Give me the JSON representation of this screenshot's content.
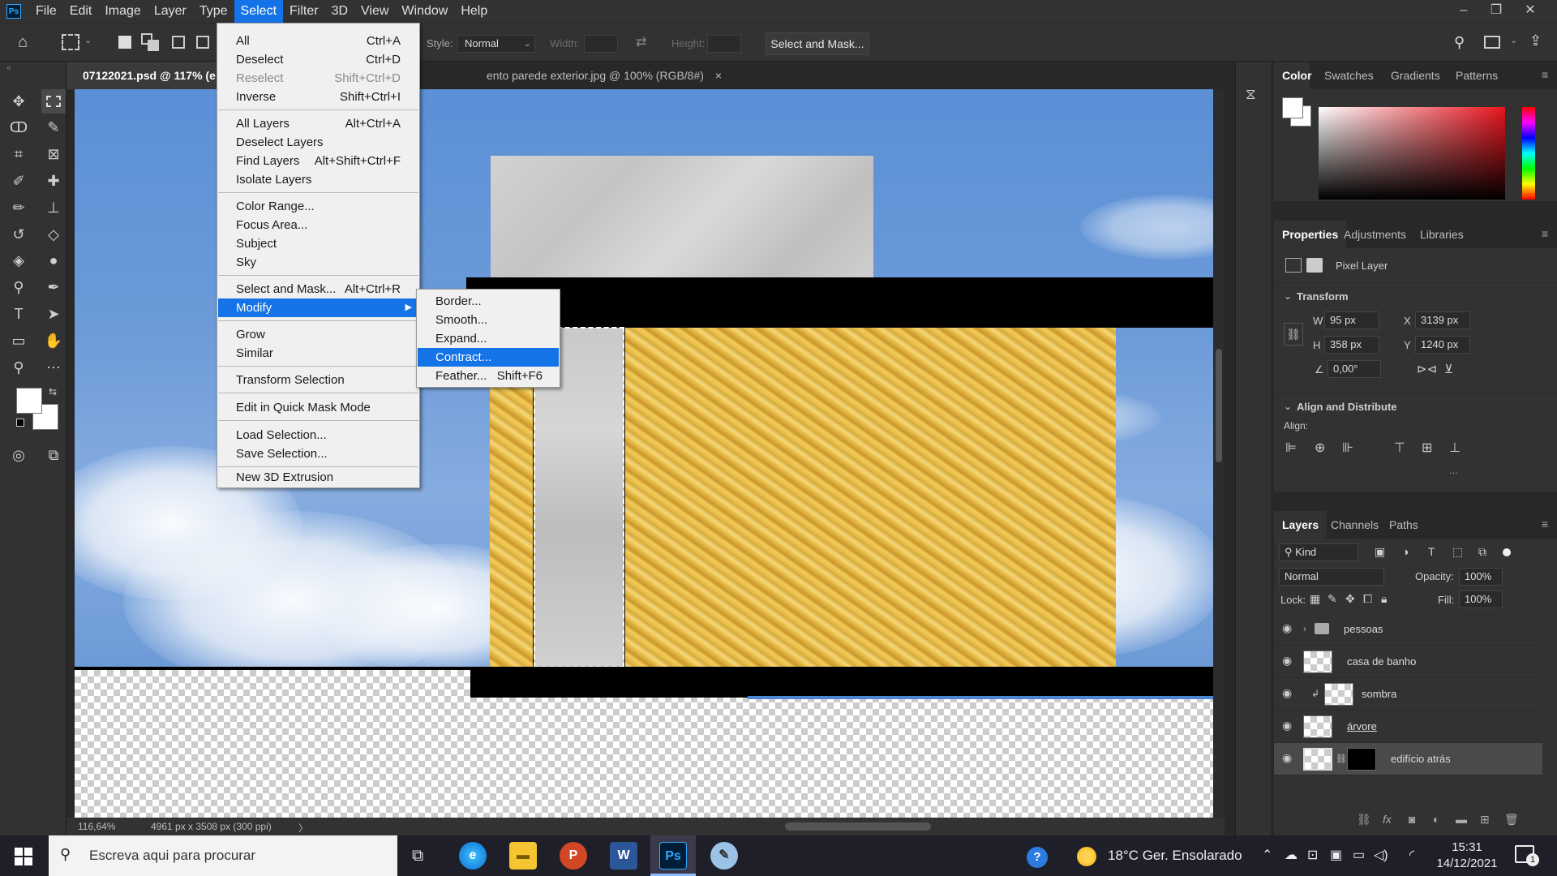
{
  "app": {
    "logo": "Ps"
  },
  "menubar": {
    "items": [
      "File",
      "Edit",
      "Image",
      "Layer",
      "Type",
      "Select",
      "Filter",
      "3D",
      "View",
      "Window",
      "Help"
    ],
    "active": "Select"
  },
  "window_controls": {
    "minimize": "–",
    "restore": "❐",
    "close": "✕"
  },
  "options": {
    "style_label": "Style:",
    "style_value": "Normal",
    "width_label": "Width:",
    "height_label": "Height:",
    "select_mask_button": "Select and Mask..."
  },
  "tabs": [
    {
      "title": "07122021.psd @ 117% (e",
      "active": true
    },
    {
      "title": "ento parede exterior.jpg @ 100% (RGB/8#)",
      "close": "×",
      "active": false
    }
  ],
  "select_menu": {
    "items": [
      {
        "label": "All",
        "shortcut": "Ctrl+A"
      },
      {
        "label": "Deselect",
        "shortcut": "Ctrl+D"
      },
      {
        "label": "Reselect",
        "shortcut": "Shift+Ctrl+D",
        "disabled": true
      },
      {
        "label": "Inverse",
        "shortcut": "Shift+Ctrl+I"
      },
      {
        "label": "All Layers",
        "shortcut": "Alt+Ctrl+A"
      },
      {
        "label": "Deselect Layers",
        "shortcut": ""
      },
      {
        "label": "Find Layers",
        "shortcut": "Alt+Shift+Ctrl+F"
      },
      {
        "label": "Isolate Layers",
        "shortcut": ""
      },
      {
        "label": "Color Range...",
        "shortcut": ""
      },
      {
        "label": "Focus Area...",
        "shortcut": ""
      },
      {
        "label": "Subject",
        "shortcut": ""
      },
      {
        "label": "Sky",
        "shortcut": ""
      },
      {
        "label": "Select and Mask...",
        "shortcut": "Alt+Ctrl+R"
      },
      {
        "label": "Modify",
        "shortcut": "",
        "submenu": true,
        "highlighted": true
      },
      {
        "label": "Grow",
        "shortcut": ""
      },
      {
        "label": "Similar",
        "shortcut": ""
      },
      {
        "label": "Transform Selection",
        "shortcut": ""
      },
      {
        "label": "Edit in Quick Mask Mode",
        "shortcut": ""
      },
      {
        "label": "Load Selection...",
        "shortcut": ""
      },
      {
        "label": "Save Selection...",
        "shortcut": ""
      },
      {
        "label": "New 3D Extrusion",
        "shortcut": ""
      }
    ]
  },
  "modify_menu": {
    "items": [
      {
        "label": "Border...",
        "shortcut": ""
      },
      {
        "label": "Smooth...",
        "shortcut": ""
      },
      {
        "label": "Expand...",
        "shortcut": ""
      },
      {
        "label": "Contract...",
        "shortcut": "",
        "highlighted": true
      },
      {
        "label": "Feather...",
        "shortcut": "Shift+F6"
      }
    ]
  },
  "status": {
    "zoom": "116,64%",
    "doc_size": "4961 px x 3508 px (300 ppi)",
    "arrow": "〉"
  },
  "color_panel": {
    "tabs": [
      "Color",
      "Swatches",
      "Gradients",
      "Patterns"
    ],
    "active": "Color"
  },
  "properties_panel": {
    "tabs": [
      "Properties",
      "Adjustments",
      "Libraries"
    ],
    "active": "Properties",
    "layer_type": "Pixel Layer",
    "transform_title": "Transform",
    "w_label": "W",
    "w": "95 px",
    "h_label": "H",
    "h": "358 px",
    "x_label": "X",
    "x": "3139 px",
    "y_label": "Y",
    "y": "1240 px",
    "angle": "0,00°",
    "align_title": "Align and Distribute",
    "align_label": "Align:",
    "more": "..."
  },
  "layers_panel": {
    "tabs": [
      "Layers",
      "Channels",
      "Paths"
    ],
    "active": "Layers",
    "filter": "Kind",
    "blend_mode": "Normal",
    "opacity_label": "Opacity:",
    "opacity": "100%",
    "lock_label": "Lock:",
    "fill_label": "Fill:",
    "fill": "100%",
    "layers": [
      {
        "name": "pessoas",
        "type": "group"
      },
      {
        "name": "casa de banho",
        "type": "pixel"
      },
      {
        "name": "sombra",
        "type": "clipped"
      },
      {
        "name": "árvore",
        "type": "pixel"
      },
      {
        "name": "edifício atrás",
        "type": "masked",
        "selected": true
      }
    ],
    "footer_icons": [
      "link-icon",
      "fx",
      "mask-icon",
      "adjustment-icon",
      "folder-icon",
      "new-layer-icon",
      "trash-icon"
    ]
  },
  "taskbar": {
    "search_placeholder": "Escreva aqui para procurar",
    "weather": "18°C Ger. Ensolarado",
    "time": "15:31",
    "date": "14/12/2021",
    "notifications": "1"
  }
}
